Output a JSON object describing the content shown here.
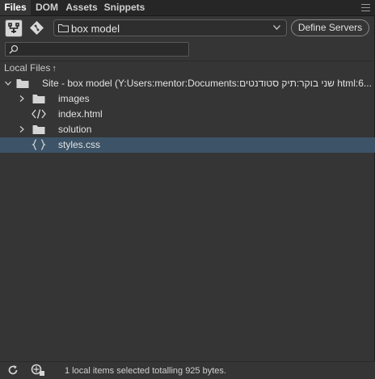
{
  "tabs": [
    {
      "label": "Files",
      "active": true
    },
    {
      "label": "DOM",
      "active": false
    },
    {
      "label": "Assets",
      "active": false
    },
    {
      "label": "Snippets",
      "active": false
    }
  ],
  "toolbar": {
    "site_name": "box model",
    "define_servers_label": "Define Servers",
    "search_placeholder": "",
    "search_value": ""
  },
  "local_files_header": "Local Files",
  "tree": [
    {
      "label": "Site - box model (Y:Users:mentor:Documents:שני בוקר:תיק סטודנטים html:6...",
      "icon": "folder-icon",
      "level": 0,
      "expanded": true
    },
    {
      "label": "images",
      "icon": "folder-icon",
      "level": 1,
      "expanded": false
    },
    {
      "label": "index.html",
      "icon": "html-file-icon",
      "level": 1
    },
    {
      "label": "solution",
      "icon": "folder-icon",
      "level": 1,
      "expanded": false
    },
    {
      "label": "styles.css",
      "icon": "css-file-icon",
      "level": 1,
      "selected": true
    }
  ],
  "status": {
    "text": "1 local items selected totalling 925 bytes."
  },
  "colors": {
    "panel_bg": "#353535",
    "tabbar_bg": "#262626",
    "selection": "#3d5468"
  }
}
